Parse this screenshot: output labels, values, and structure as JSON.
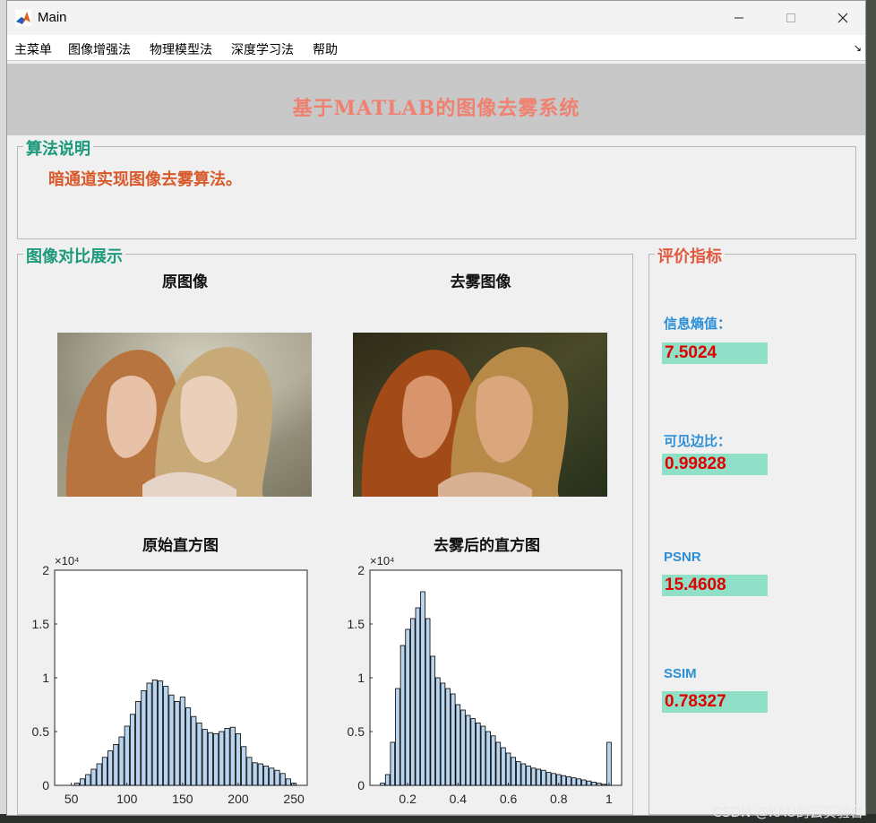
{
  "window": {
    "title": "Main"
  },
  "menu": {
    "items": [
      "主菜单",
      "图像增强法",
      "物理模型法",
      "深度学习法",
      "帮助"
    ]
  },
  "banner": {
    "title": "基于MATLAB的图像去雾系统"
  },
  "algo_panel": {
    "title": "算法说明",
    "text": "暗通道实现图像去雾算法。"
  },
  "compare_panel": {
    "title": "图像对比展示",
    "original_caption": "原图像",
    "dehazed_caption": "去雾图像",
    "hist1_caption": "原始直方图",
    "hist2_caption": "去雾后的直方图"
  },
  "metrics_panel": {
    "title": "评价指标",
    "items": [
      {
        "label": "信息熵值：",
        "value": "7.5024"
      },
      {
        "label": "可见边比：",
        "value": "0.99828"
      },
      {
        "label": "PSNR",
        "value": "15.4608"
      },
      {
        "label": "SSIM",
        "value": "0.78327"
      }
    ]
  },
  "watermark": "CSDN @KAU的云实验台",
  "colors": {
    "banner_title": "#f08070",
    "panel_title_teal": "#1a9a7a",
    "panel_title_red": "#e05a40",
    "algo_text": "#d85a2a",
    "metric_label": "#2c8fd6",
    "metric_value": "#e00000",
    "metric_bg": "#90e0c8"
  },
  "chart_data": [
    {
      "type": "bar",
      "title": "原始直方图",
      "xlim": [
        35,
        262
      ],
      "ylim": [
        0,
        2
      ],
      "y_exponent_label": "×10⁴",
      "xticks": [
        50,
        100,
        150,
        200,
        250
      ],
      "yticks": [
        0,
        0.5,
        1,
        1.5,
        2
      ],
      "x": [
        50,
        55,
        60,
        65,
        70,
        75,
        80,
        85,
        90,
        95,
        100,
        105,
        110,
        115,
        120,
        125,
        130,
        135,
        140,
        145,
        150,
        155,
        160,
        165,
        170,
        175,
        180,
        185,
        190,
        195,
        200,
        205,
        210,
        215,
        220,
        225,
        230,
        235,
        240,
        245,
        250,
        255
      ],
      "values": [
        0,
        0.02,
        0.06,
        0.1,
        0.15,
        0.2,
        0.26,
        0.32,
        0.38,
        0.45,
        0.55,
        0.66,
        0.78,
        0.88,
        0.95,
        0.98,
        0.97,
        0.92,
        0.84,
        0.78,
        0.82,
        0.72,
        0.64,
        0.58,
        0.52,
        0.49,
        0.48,
        0.5,
        0.53,
        0.54,
        0.48,
        0.36,
        0.26,
        0.21,
        0.2,
        0.18,
        0.16,
        0.14,
        0.11,
        0.06,
        0.02,
        0
      ]
    },
    {
      "type": "bar",
      "title": "去雾后的直方图",
      "xlim": [
        0.05,
        1.05
      ],
      "ylim": [
        0,
        2
      ],
      "y_exponent_label": "×10⁴",
      "xticks": [
        0.2,
        0.4,
        0.6,
        0.8,
        1
      ],
      "xtick_labels": [
        "0.2",
        "0.4",
        "0.6",
        "0.8",
        "1"
      ],
      "yticks": [
        0,
        0.5,
        1,
        1.5,
        2
      ],
      "x": [
        0.1,
        0.12,
        0.14,
        0.16,
        0.18,
        0.2,
        0.22,
        0.24,
        0.26,
        0.28,
        0.3,
        0.32,
        0.34,
        0.36,
        0.38,
        0.4,
        0.42,
        0.44,
        0.46,
        0.48,
        0.5,
        0.52,
        0.54,
        0.56,
        0.58,
        0.6,
        0.62,
        0.64,
        0.66,
        0.68,
        0.7,
        0.72,
        0.74,
        0.76,
        0.78,
        0.8,
        0.82,
        0.84,
        0.86,
        0.88,
        0.9,
        0.92,
        0.94,
        0.96,
        0.98,
        1.0
      ],
      "values": [
        0.02,
        0.1,
        0.4,
        0.9,
        1.3,
        1.45,
        1.55,
        1.65,
        1.8,
        1.55,
        1.2,
        1.0,
        0.95,
        0.9,
        0.85,
        0.75,
        0.7,
        0.65,
        0.62,
        0.58,
        0.55,
        0.5,
        0.46,
        0.4,
        0.35,
        0.3,
        0.26,
        0.22,
        0.2,
        0.18,
        0.16,
        0.15,
        0.14,
        0.12,
        0.11,
        0.1,
        0.09,
        0.08,
        0.07,
        0.06,
        0.05,
        0.04,
        0.03,
        0.02,
        0.01,
        0.4
      ]
    }
  ]
}
